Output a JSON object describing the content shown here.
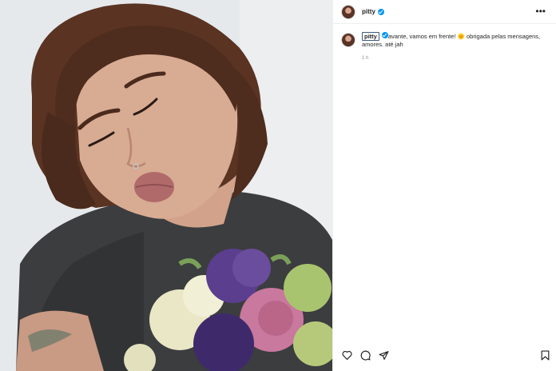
{
  "post": {
    "username": "pitty",
    "verified": true,
    "caption": {
      "username": "pitty",
      "text_before_emoji": "avante, vamos em frente!",
      "emoji": "🌞",
      "text_after_emoji": "obrigada pelas mensagens, amores. até jah",
      "timestamp": "1 h"
    }
  },
  "icons": {
    "more": "more-options-icon",
    "like": "heart-icon",
    "comment": "comment-icon",
    "share": "share-icon",
    "save": "bookmark-icon",
    "verified": "verified-badge-icon"
  },
  "colors": {
    "verified_blue": "#0095f6",
    "text": "#262626",
    "muted": "#8e8e8e",
    "border": "#efefef"
  }
}
